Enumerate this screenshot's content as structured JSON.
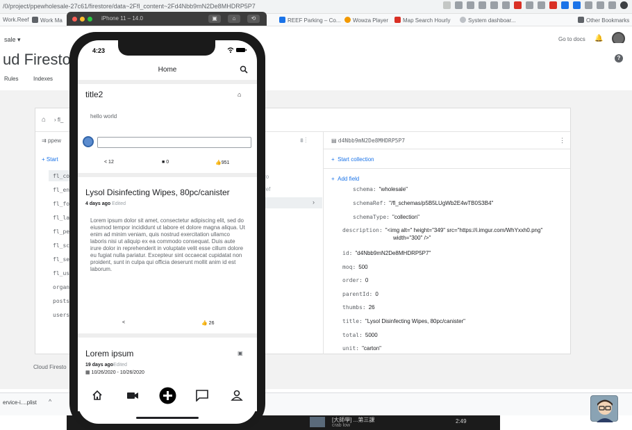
{
  "browser": {
    "url": "/0/project/ppewholesale-27c61/firestore/data~2Ffl_content~2Fd4Nbb9mN2De8MHDRP5P7",
    "bookmarks": [
      "Work.Reef",
      "Work Ma",
      "REEF Parking – Co...",
      "Wowza Player",
      "Map Search Hourly",
      "System dashboar...",
      "Other Bookmarks"
    ]
  },
  "simulator": {
    "title": "iPhone 11 – 14.0"
  },
  "console": {
    "project": "sale",
    "title": "ud Firestore",
    "go_to_docs": "Go to docs",
    "tabs": [
      "Rules",
      "Indexes"
    ],
    "collection_header": "ppew",
    "breadcrumb": "fl_",
    "start_collection_left": "Start",
    "collections": [
      "fl_co",
      "fl_en",
      "fl_fo",
      "fl_la",
      "fl_pe",
      "fl_sc",
      "fl_se",
      "fl_us",
      "organ",
      "posts",
      "users"
    ],
    "doc_col_hint": "ro",
    "doc_col_hint2": "ref",
    "doc_id": "d4Nbb9mN2De8MHDRP5P7",
    "start_collection": "Start collection",
    "add_field": "Add field",
    "fields": [
      {
        "key": "schema:",
        "value": "\"wholesale\""
      },
      {
        "key": "schemaRef:",
        "value": "\"/fl_schemas/p5B5LUgWb2E4wTB0S3B4\""
      },
      {
        "key": "schemaType:",
        "value": "\"collection\""
      },
      {
        "key": "description:",
        "value": "\"<img alt=\" height=\"349\" src=\"https://i.imgur.com/WhYxxh0.png\""
      },
      {
        "key": "",
        "value": "width=\"300\" />\""
      },
      {
        "key": "id:",
        "value": "\"d4Nbb9mN2De8MHDRP5P7\""
      },
      {
        "key": "moq:",
        "value": "500"
      },
      {
        "key": "order:",
        "value": "0"
      },
      {
        "key": "parentId:",
        "value": "0"
      },
      {
        "key": "thumbs:",
        "value": "26"
      },
      {
        "key": "title:",
        "value": "\"Lysol Disinfecting Wipes, 80pc/canister\""
      },
      {
        "key": "total:",
        "value": "5000"
      },
      {
        "key": "unit:",
        "value": "\"carton\""
      }
    ],
    "footer": "Cloud Firesto"
  },
  "downloads": {
    "item": "ervice-i....plist"
  },
  "video": {
    "title": "[大師學] ...第三課",
    "subtitle": "crab low",
    "time": "2:49"
  },
  "phone": {
    "time": "4:23",
    "status": "ᯤ ▬",
    "app_title": "Home",
    "posts": [
      {
        "title": "title2",
        "body": "hello world",
        "shares": "12",
        "comments": "0",
        "likes": "951"
      },
      {
        "title": "Lysol Disinfecting Wipes, 80pc/canister",
        "age": "4 days ago",
        "edited": "Edited",
        "body": "Lorem ipsum dolor sit amet, consectetur adipiscing elit, sed do eiusmod tempor incididunt ut labore et dolore magna aliqua. Ut enim ad minim veniam, quis nostrud exercitation ullamco laboris nisi ut aliquip ex ea commodo consequat. Duis aute irure dolor in reprehenderit in voluptate velit esse cillum dolore eu fugiat nulla pariatur. Excepteur sint occaecat cupidatat non proident, sunt in culpa qui officia deserunt mollit anim id est laborum.",
        "likes": "26"
      },
      {
        "title": "Lorem ipsum",
        "age": "19 days ago",
        "edited": "Edited",
        "dates": "10/26/2020 - 10/26/2020"
      }
    ]
  }
}
